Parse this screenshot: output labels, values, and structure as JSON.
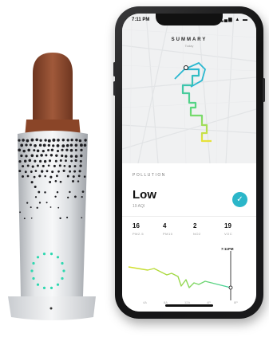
{
  "phone": {
    "status_time": "7:11 PM",
    "status_icons": "▂▄▆ ▲ ▬"
  },
  "map": {
    "title": "SUMMARY",
    "subtitle": "Today"
  },
  "pollution": {
    "section_label": "POLLUTION",
    "level": "Low",
    "aqi": "19 AQI",
    "status_color": "#2bb6c9",
    "metrics": [
      {
        "value": "16",
        "label": "PM2.5"
      },
      {
        "value": "4",
        "label": "PM10"
      },
      {
        "value": "2",
        "label": "NO2"
      },
      {
        "value": "19",
        "label": "VOC"
      }
    ]
  },
  "chart": {
    "time_label": "7:11PM",
    "x_labels": [
      "4A",
      "8A",
      "12A",
      "4P",
      "8P"
    ]
  },
  "device": {
    "led_color": "#2fd8b0",
    "strap_color": "#8b4a2f"
  }
}
